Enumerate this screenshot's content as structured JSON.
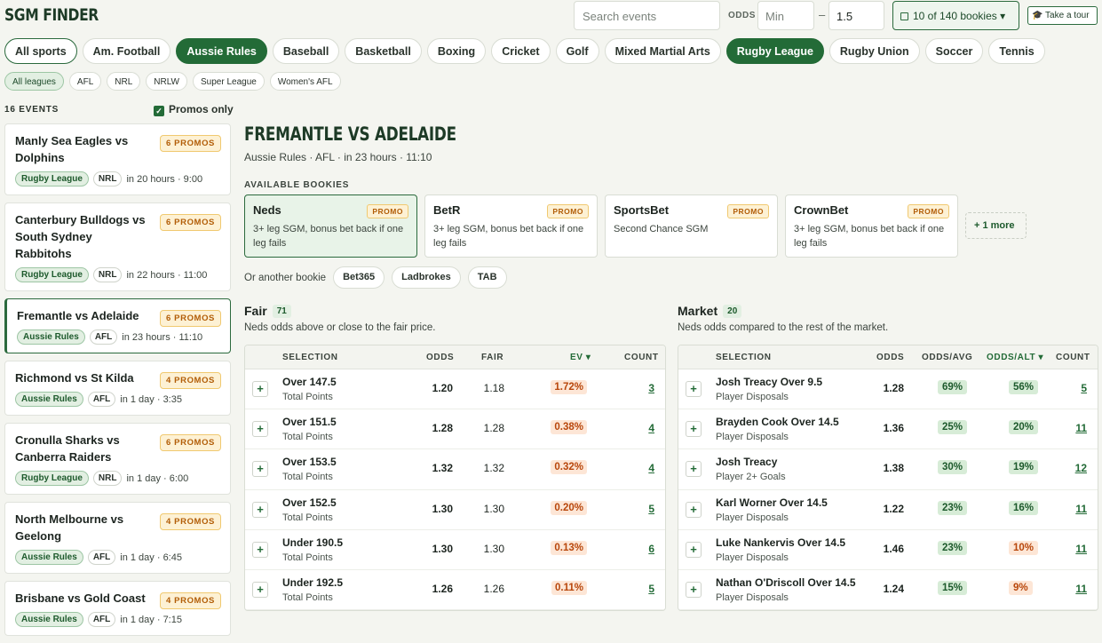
{
  "app": {
    "title": "SGM FINDER"
  },
  "search": {
    "placeholder": "Search events"
  },
  "odds_filter": {
    "label": "ODDS",
    "min_placeholder": "Min",
    "dash": "–",
    "max_value": "1.5"
  },
  "bookies_button": {
    "label": "10 of 140 bookies ▾"
  },
  "tour_button": {
    "label": "🎓 Take a tour"
  },
  "sports": [
    {
      "label": "All sports",
      "state": "outline"
    },
    {
      "label": "Am. Football",
      "state": "off"
    },
    {
      "label": "Aussie Rules",
      "state": "on"
    },
    {
      "label": "Baseball",
      "state": "off"
    },
    {
      "label": "Basketball",
      "state": "off"
    },
    {
      "label": "Boxing",
      "state": "off"
    },
    {
      "label": "Cricket",
      "state": "off"
    },
    {
      "label": "Golf",
      "state": "off"
    },
    {
      "label": "Mixed Martial Arts",
      "state": "off"
    },
    {
      "label": "Rugby League",
      "state": "on"
    },
    {
      "label": "Rugby Union",
      "state": "off"
    },
    {
      "label": "Soccer",
      "state": "off"
    },
    {
      "label": "Tennis",
      "state": "off"
    }
  ],
  "leagues": [
    {
      "label": "All leagues",
      "on": true
    },
    {
      "label": "AFL",
      "on": false
    },
    {
      "label": "NRL",
      "on": false
    },
    {
      "label": "NRLW",
      "on": false
    },
    {
      "label": "Super League",
      "on": false
    },
    {
      "label": "Women's AFL",
      "on": false
    }
  ],
  "events_header": {
    "count_label": "16 EVENTS",
    "promos_only_label": "Promos only",
    "promos_only_checked": true
  },
  "events": [
    {
      "name": "Manly Sea Eagles vs Dolphins",
      "promos": "6 PROMOS",
      "sport": "Rugby League",
      "league": "NRL",
      "when": "in 20 hours · 9:00",
      "selected": false
    },
    {
      "name": "Canterbury Bulldogs vs South Sydney Rabbitohs",
      "promos": "6 PROMOS",
      "sport": "Rugby League",
      "league": "NRL",
      "when": "in 22 hours · 11:00",
      "selected": false
    },
    {
      "name": "Fremantle vs Adelaide",
      "promos": "6 PROMOS",
      "sport": "Aussie Rules",
      "league": "AFL",
      "when": "in 23 hours · 11:10",
      "selected": true
    },
    {
      "name": "Richmond vs St Kilda",
      "promos": "4 PROMOS",
      "sport": "Aussie Rules",
      "league": "AFL",
      "when": "in 1 day · 3:35",
      "selected": false
    },
    {
      "name": "Cronulla Sharks vs Canberra Raiders",
      "promos": "6 PROMOS",
      "sport": "Rugby League",
      "league": "NRL",
      "when": "in 1 day · 6:00",
      "selected": false
    },
    {
      "name": "North Melbourne vs Geelong",
      "promos": "4 PROMOS",
      "sport": "Aussie Rules",
      "league": "AFL",
      "when": "in 1 day · 6:45",
      "selected": false
    },
    {
      "name": "Brisbane vs Gold Coast",
      "promos": "4 PROMOS",
      "sport": "Aussie Rules",
      "league": "AFL",
      "when": "in 1 day · 7:15",
      "selected": false
    }
  ],
  "main": {
    "title": "FREMANTLE VS ADELAIDE",
    "subtitle": "Aussie Rules · AFL · in 23 hours · 11:10",
    "available_label": "AVAILABLE BOOKIES",
    "bookies": [
      {
        "name": "Neds",
        "badge": "PROMO",
        "desc": "3+ leg SGM, bonus bet back if one leg fails",
        "on": true
      },
      {
        "name": "BetR",
        "badge": "PROMO",
        "desc": "3+ leg SGM, bonus bet back if one leg fails",
        "on": false
      },
      {
        "name": "SportsBet",
        "badge": "PROMO",
        "desc": "Second Chance SGM",
        "on": false
      },
      {
        "name": "CrownBet",
        "badge": "PROMO",
        "desc": "3+ leg SGM, bonus bet back if one leg fails",
        "on": false
      }
    ],
    "more_label": "+ 1 more",
    "another_label": "Or another bookie",
    "other_bookies": [
      "Bet365",
      "Ladbrokes",
      "TAB"
    ]
  },
  "fair": {
    "title": "Fair",
    "count": "71",
    "desc": "Neds odds above or close to the fair price.",
    "columns": {
      "selection": "SELECTION",
      "odds": "ODDS",
      "fair": "FAIR",
      "ev": "EV ▾",
      "count": "COUNT"
    },
    "rows": [
      {
        "sel": "Over 147.5",
        "mkt": "Total Points",
        "odds": "1.20",
        "fair": "1.18",
        "ev": "1.72%",
        "count": "3"
      },
      {
        "sel": "Over 151.5",
        "mkt": "Total Points",
        "odds": "1.28",
        "fair": "1.28",
        "ev": "0.38%",
        "count": "4"
      },
      {
        "sel": "Over 153.5",
        "mkt": "Total Points",
        "odds": "1.32",
        "fair": "1.32",
        "ev": "0.32%",
        "count": "4"
      },
      {
        "sel": "Over 152.5",
        "mkt": "Total Points",
        "odds": "1.30",
        "fair": "1.30",
        "ev": "0.20%",
        "count": "5"
      },
      {
        "sel": "Under 190.5",
        "mkt": "Total Points",
        "odds": "1.30",
        "fair": "1.30",
        "ev": "0.13%",
        "count": "6"
      },
      {
        "sel": "Under 192.5",
        "mkt": "Total Points",
        "odds": "1.26",
        "fair": "1.26",
        "ev": "0.11%",
        "count": "5"
      }
    ]
  },
  "market": {
    "title": "Market",
    "count": "20",
    "desc": "Neds odds compared to the rest of the market.",
    "columns": {
      "selection": "SELECTION",
      "odds": "ODDS",
      "odds_avg": "ODDS/AVG",
      "odds_alt": "ODDS/ALT ▾",
      "count": "COUNT"
    },
    "rows": [
      {
        "sel": "Josh Treacy Over 9.5",
        "mkt": "Player Disposals",
        "odds": "1.28",
        "avg": "69%",
        "alt": "56%",
        "alt_tone": "g",
        "count": "5"
      },
      {
        "sel": "Brayden Cook Over 14.5",
        "mkt": "Player Disposals",
        "odds": "1.36",
        "avg": "25%",
        "alt": "20%",
        "alt_tone": "g",
        "count": "11"
      },
      {
        "sel": "Josh Treacy",
        "mkt": "Player 2+ Goals",
        "odds": "1.38",
        "avg": "30%",
        "alt": "19%",
        "alt_tone": "g",
        "count": "12"
      },
      {
        "sel": "Karl Worner Over 14.5",
        "mkt": "Player Disposals",
        "odds": "1.22",
        "avg": "23%",
        "alt": "16%",
        "alt_tone": "g",
        "count": "11"
      },
      {
        "sel": "Luke Nankervis Over 14.5",
        "mkt": "Player Disposals",
        "odds": "1.46",
        "avg": "23%",
        "alt": "10%",
        "alt_tone": "o",
        "count": "11"
      },
      {
        "sel": "Nathan O'Driscoll Over 14.5",
        "mkt": "Player Disposals",
        "odds": "1.24",
        "avg": "15%",
        "alt": "9%",
        "alt_tone": "o",
        "count": "11"
      }
    ]
  }
}
